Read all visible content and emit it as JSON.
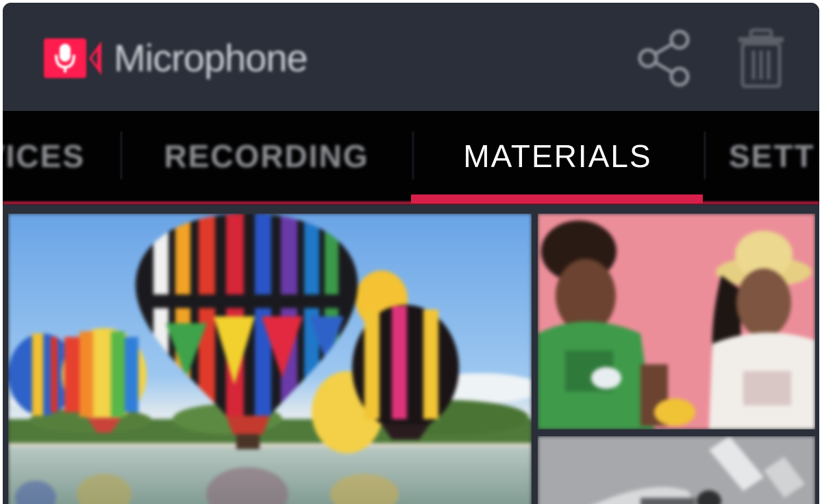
{
  "app": {
    "title": "Microphone",
    "brand_color": "#ff1c4f",
    "logo_icon": "microphone-video-icon"
  },
  "actions": [
    {
      "name": "share",
      "icon": "share-icon"
    },
    {
      "name": "delete",
      "icon": "trash-icon"
    }
  ],
  "tabs": [
    {
      "label": "VICES",
      "active": false
    },
    {
      "label": "RECORDING",
      "active": false
    },
    {
      "label": "MATERIALS",
      "active": true
    },
    {
      "label": "SETT",
      "active": false
    }
  ],
  "colors": {
    "appbar_bg": "#2a2f39",
    "tabbar_bg": "#020203",
    "accent": "#d81f4a",
    "tab_active_text": "#ffffff",
    "tab_inactive_text": "#8c8e92"
  },
  "gallery": {
    "tiles": [
      {
        "subject": "hot-air-balloons-over-lake"
      },
      {
        "subject": "two-children-against-pink-wall"
      },
      {
        "subject": "black-and-white-photo"
      }
    ]
  }
}
